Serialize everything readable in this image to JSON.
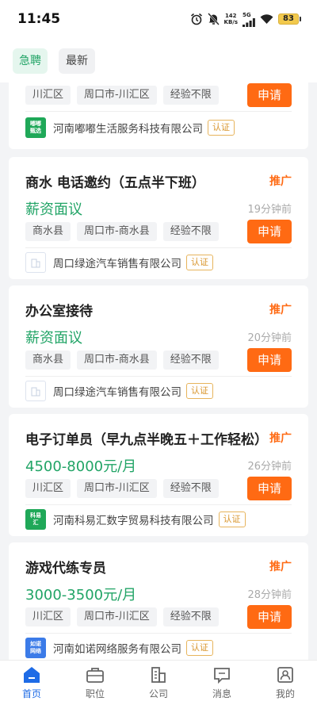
{
  "status_bar": {
    "time": "11:45",
    "net_speed_value": "142",
    "net_speed_unit": "KB/s",
    "network": "5G",
    "battery": "83"
  },
  "tabs": [
    {
      "label": "急聘",
      "active": true
    },
    {
      "label": "最新",
      "active": false
    }
  ],
  "jobs": [
    {
      "title": "",
      "promo": "",
      "salary": "",
      "posted": "",
      "tags": [
        "川汇区",
        "周口市-川汇区",
        "经验不限"
      ],
      "apply": "申请",
      "company": {
        "logo_text": "嘟嘟\n甄选",
        "logo_color": "green",
        "name": "河南嘟嘟生活服务科技有限公司",
        "badge": "认证"
      }
    },
    {
      "title": "商水 电话邀约（五点半下班）",
      "promo": "推广",
      "salary": "薪资面议",
      "posted": "19分钟前",
      "tags": [
        "商水县",
        "周口市-商水县",
        "经验不限"
      ],
      "apply": "申请",
      "company": {
        "logo_text": "",
        "logo_color": "outline",
        "name": "周口绿途汽车销售有限公司",
        "badge": "认证"
      }
    },
    {
      "title": "办公室接待",
      "promo": "推广",
      "salary": "薪资面议",
      "posted": "20分钟前",
      "tags": [
        "商水县",
        "周口市-商水县",
        "经验不限"
      ],
      "apply": "申请",
      "company": {
        "logo_text": "",
        "logo_color": "outline",
        "name": "周口绿途汽车销售有限公司",
        "badge": "认证"
      }
    },
    {
      "title": "电子订单员（早九点半晚五＋工作轻松）",
      "promo": "推广",
      "salary": "4500-8000元/月",
      "posted": "26分钟前",
      "tags": [
        "川汇区",
        "周口市-川汇区",
        "经验不限"
      ],
      "apply": "申请",
      "company": {
        "logo_text": "科易\n汇",
        "logo_color": "green",
        "name": "河南科易汇数字贸易科技有限公司",
        "badge": "认证"
      }
    },
    {
      "title": "游戏代练专员",
      "promo": "推广",
      "salary": "3000-3500元/月",
      "posted": "28分钟前",
      "tags": [
        "川汇区",
        "周口市-川汇区",
        "经验不限"
      ],
      "apply": "申请",
      "company": {
        "logo_text": "如诺\n网络",
        "logo_color": "blue",
        "name": "河南如诺网络服务有限公司",
        "badge": "认证"
      }
    }
  ],
  "bottom_nav": [
    {
      "label": "首页",
      "icon": "home-icon",
      "active": true
    },
    {
      "label": "职位",
      "icon": "briefcase-icon",
      "active": false
    },
    {
      "label": "公司",
      "icon": "building-icon",
      "active": false
    },
    {
      "label": "消息",
      "icon": "message-icon",
      "active": false
    },
    {
      "label": "我的",
      "icon": "profile-icon",
      "active": false
    }
  ],
  "colors": {
    "accent_green": "#21a466",
    "accent_orange": "#ff6a13",
    "nav_active": "#1e6be6"
  }
}
